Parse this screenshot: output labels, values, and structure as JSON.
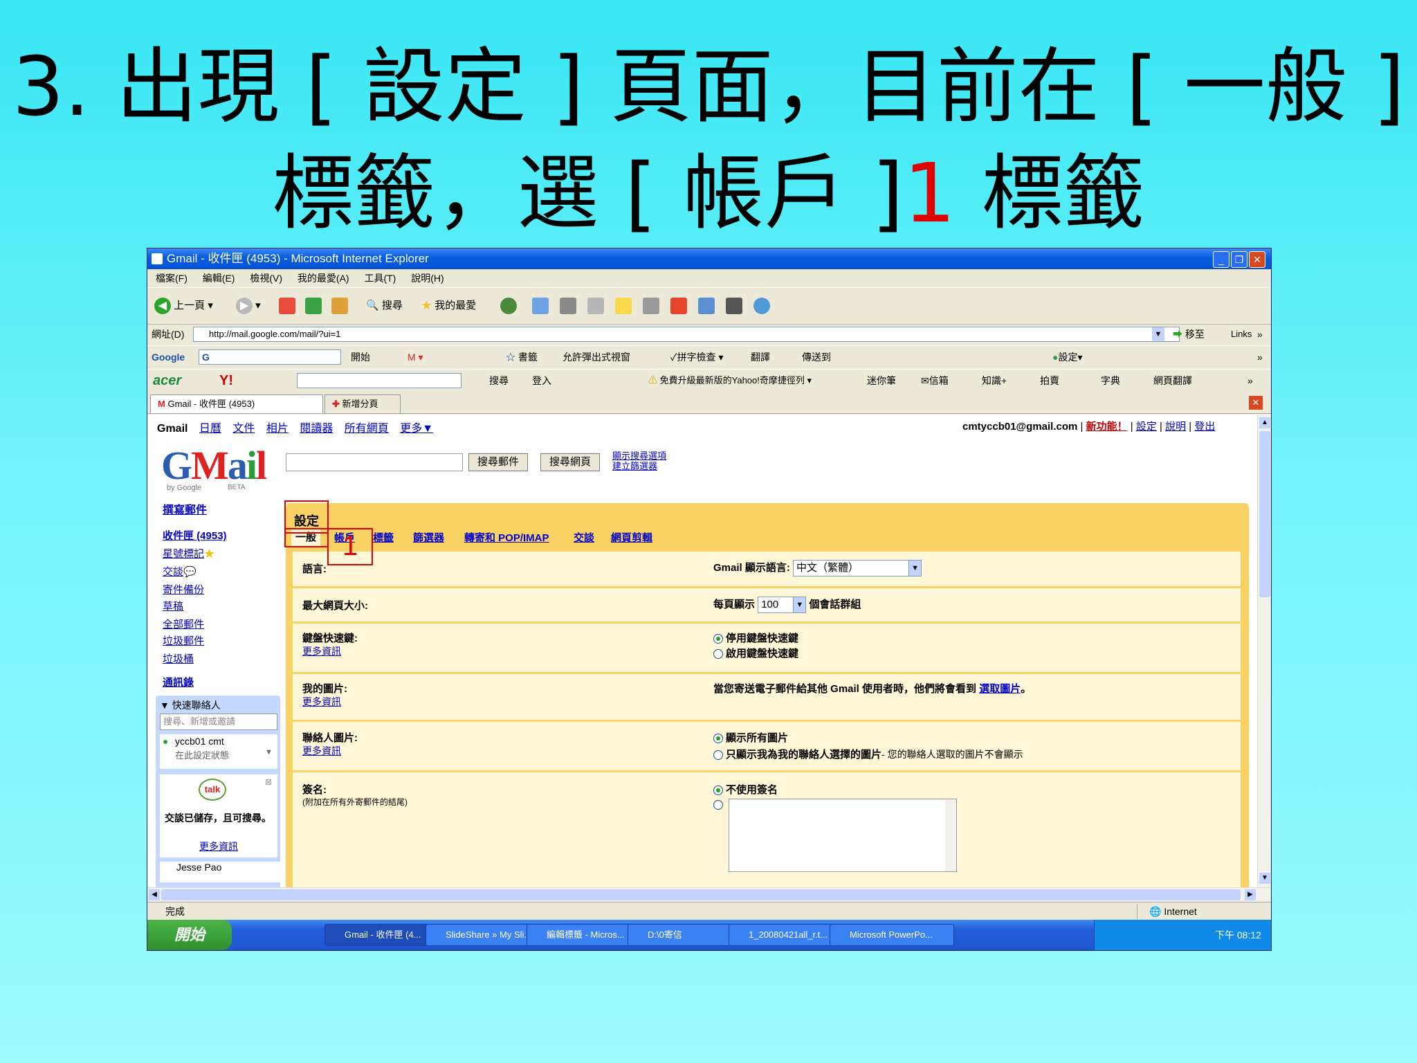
{
  "slide": {
    "line1": "3. 出現 [ 設定 ] 頁面，目前在 [ 一般 ]",
    "line2_a": "標籤，選 [ 帳戶 ]",
    "line2_num": "1",
    "line2_b": " 標籤"
  },
  "window": {
    "title": "Gmail - 收件匣 (4953) - Microsoft Internet Explorer",
    "menu": [
      "檔案(F)",
      "編輯(E)",
      "檢視(V)",
      "我的最愛(A)",
      "工具(T)",
      "說明(H)"
    ],
    "toolbar": {
      "back": "上一頁",
      "search": "搜尋",
      "favorites": "我的最愛"
    },
    "address_label": "網址(D)",
    "address": "http://mail.google.com/mail/?ui=1",
    "go": "移至",
    "links": "Links",
    "google_bar": {
      "brand": "Google",
      "engine": "G",
      "start": "開始",
      "bookmarks": "書籤",
      "popups": "允許彈出式視窗",
      "spell": "拼字檢查",
      "translate": "翻譯",
      "send": "傳送到",
      "settings": "設定"
    },
    "yahoo_bar": {
      "brand": "acer",
      "yahoo": "Y!",
      "search": "搜尋",
      "login": "登入",
      "upgrade": "免費升級最新版的Yahoo!奇摩捷徑列",
      "notes": "迷你筆",
      "mail": "信箱",
      "knowledge": "知識+",
      "auction": "拍賣",
      "dict": "字典",
      "web_translate": "網頁翻譯"
    },
    "tabs": [
      "Gmail - 收件匣 (4953)",
      "新增分頁"
    ],
    "status": "完成",
    "zone": "Internet"
  },
  "gmail": {
    "topnav": [
      "Gmail",
      "日曆",
      "文件",
      "相片",
      "閱讀器",
      "所有網頁",
      "更多▼"
    ],
    "account": "cmtyccb01@gmail.com",
    "new_feature": "新功能！",
    "top_links": [
      "設定",
      "說明",
      "登出"
    ],
    "search_mail_btn": "搜尋郵件",
    "search_web_btn": "搜尋網頁",
    "show_options": "顯示搜尋選項",
    "create_filter": "建立篩選器",
    "logo_sub": "by Google",
    "logo_beta": "BETA",
    "compose": "撰寫郵件",
    "nav": [
      "收件匣 (4953)",
      "星號標記",
      "交談",
      "寄件備份",
      "草稿",
      "全部郵件",
      "垃圾郵件",
      "垃圾桶"
    ],
    "contacts": "通訊錄",
    "quick_contacts": "快速聯絡人",
    "qc_placeholder": "搜尋、新增或邀請",
    "qc_user": "yccb01 cmt",
    "qc_status": "在此設定狀態",
    "talk_logo": "talk",
    "talk_msg": "交談已儲存，且可搜尋。",
    "talk_more": "更多資訊",
    "qc_next": "Jesse Pao",
    "settings_title": "設定",
    "settings_tabs": [
      "一般",
      "帳戶",
      "標籤",
      "篩選器",
      "轉寄和 POP/IMAP",
      "交談",
      "網頁剪輯"
    ],
    "annotation_num": "1",
    "rows": {
      "lang_label": "語言:",
      "lang_value_label": "Gmail 顯示語言:",
      "lang_value": "中文（繁體）",
      "page_label": "最大網頁大小:",
      "page_pre": "每頁顯示",
      "page_value": "100",
      "page_post": "個會話群組",
      "kbd_label": "鍵盤快速鍵:",
      "kbd_more": "更多資訊",
      "kbd_off": "停用鍵盤快速鍵",
      "kbd_on": "啟用鍵盤快速鍵",
      "pic_label": "我的圖片:",
      "pic_more": "更多資訊",
      "pic_text": "當您寄送電子郵件給其他 Gmail 使用者時，他們將會看到",
      "pic_link": "選取圖片",
      "pic_end": "。",
      "cpic_label": "聯絡人圖片:",
      "cpic_more": "更多資訊",
      "cpic_all": "顯示所有圖片",
      "cpic_mine": "只顯示我為我的聯絡人選擇的圖片",
      "cpic_note": "- 您的聯絡人選取的圖片不會顯示",
      "sig_label": "簽名:",
      "sig_note": "(附加在所有外寄郵件的結尾)",
      "sig_none": "不使用簽名"
    }
  },
  "taskbar": {
    "start": "開始",
    "items": [
      "Gmail - 收件匣 (4...",
      "SlideShare » My Sli...",
      "編輯標籤 - Micros...",
      "D:\\0寄信",
      "1_20080421all_r.t...",
      "Microsoft PowerPo..."
    ],
    "clock": "下午 08:12"
  },
  "colors": {
    "accent_red": "#e00000",
    "settings_bg": "#fad163",
    "link": "#0000cc"
  }
}
